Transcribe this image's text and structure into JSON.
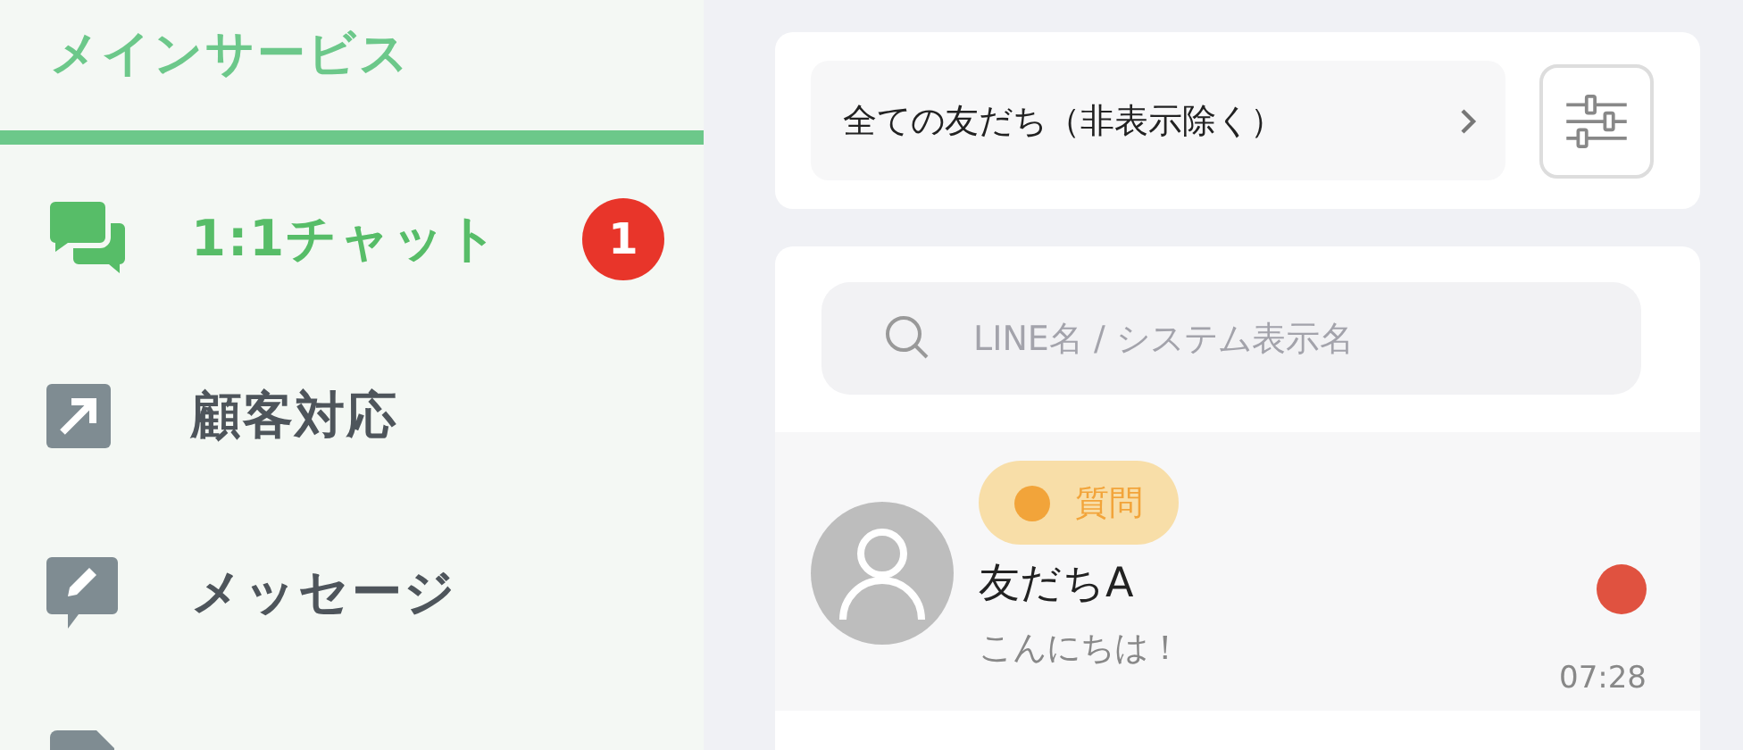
{
  "sidebar": {
    "section_title": "メインサービス",
    "items": [
      {
        "label": "1:1チャット",
        "selected": true,
        "badge": "1"
      },
      {
        "label": "顧客対応",
        "selected": false
      },
      {
        "label": "メッセージ",
        "selected": false
      }
    ]
  },
  "filter": {
    "label": "全ての友だち（非表示除く）"
  },
  "search": {
    "placeholder": "LINE名 / システム表示名"
  },
  "chats": [
    {
      "tag": {
        "label": "質問",
        "color": "#f2a43a"
      },
      "name": "友だちA",
      "preview": "こんにちは！",
      "time": "07:28",
      "unread": true
    }
  ]
}
